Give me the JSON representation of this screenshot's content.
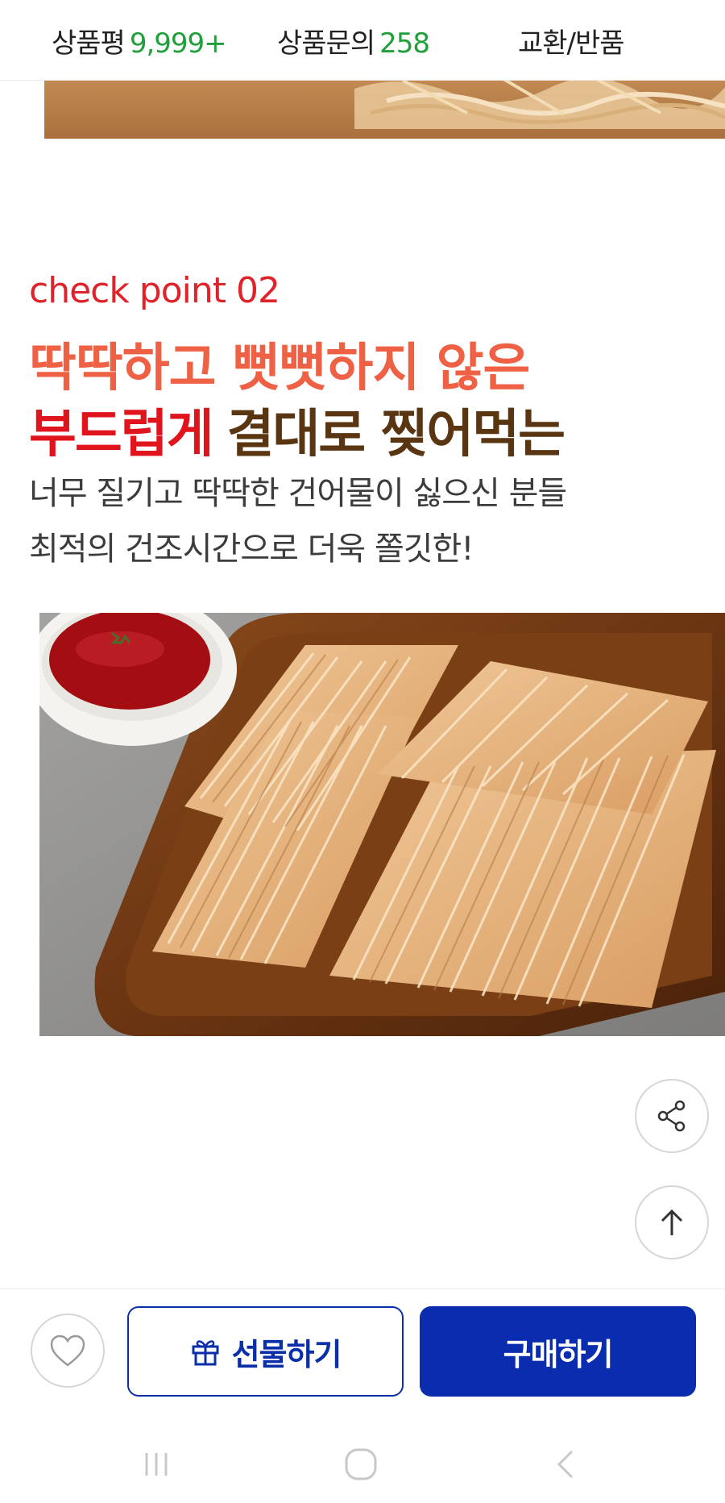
{
  "tabs": {
    "reviews_label": "상품평",
    "reviews_count": "9,999+",
    "qna_label": "상품문의",
    "qna_count": "258",
    "exchange_label": "교환/반품"
  },
  "content": {
    "check_label": "check point 02",
    "headline_line1": "딱딱하고 뻣뻣하지 않은",
    "headline_line2_red": "부드럽게",
    "headline_line2_brown": "결대로 찢어먹는",
    "desc_line1": "너무 질기고 딱딱한 건어물이 싫으신 분들",
    "desc_line2": "최적의 건조시간으로 더욱 쫄깃한!"
  },
  "actions": {
    "gift_label": "선물하기",
    "buy_label": "구매하기"
  },
  "icons": {
    "share": "share-icon",
    "scroll_top": "arrow-up-icon",
    "wish": "heart-icon",
    "gift": "gift-icon",
    "nav_recent": "recent-apps-icon",
    "nav_home": "home-icon",
    "nav_back": "back-icon"
  },
  "colors": {
    "accent_green": "#20a03a",
    "check_red": "#e0232a",
    "headline_orange": "#ef6145",
    "headline_red": "#e0141d",
    "headline_brown": "#5a3512",
    "primary_blue": "#0a2db0"
  }
}
